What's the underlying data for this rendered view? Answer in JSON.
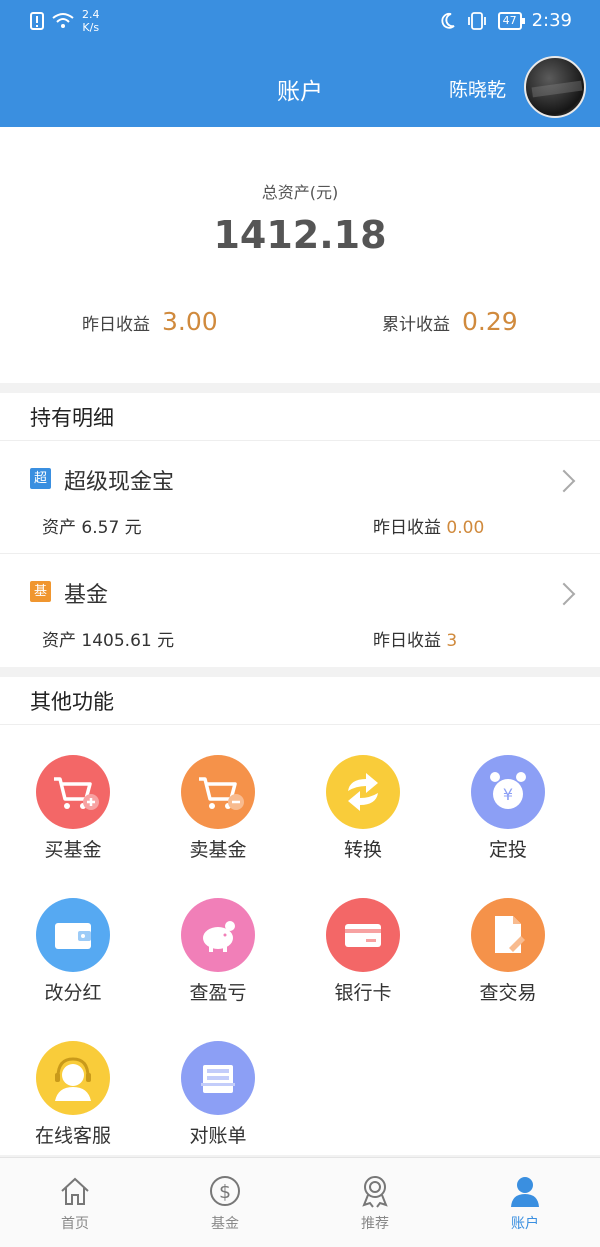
{
  "status_bar": {
    "speed_value": "2.4",
    "speed_unit": "K/s",
    "battery": "47",
    "time": "2:39"
  },
  "header": {
    "title": "账户",
    "username": "陈晓乾"
  },
  "summary": {
    "total_label": "总资产(元)",
    "total_value": "1412.18",
    "yesterday_label": "昨日收益",
    "yesterday_value": "3.00",
    "cumulative_label": "累计收益",
    "cumulative_value": "0.29"
  },
  "holdings": {
    "title": "持有明细",
    "items": [
      {
        "tag": "超",
        "name": "超级现金宝",
        "asset_text": "资产 6.57 元",
        "income_label": "昨日收益 ",
        "income_value": "0.00"
      },
      {
        "tag": "基",
        "name": "基金",
        "asset_text": "资产 1405.61 元",
        "income_label": "昨日收益 ",
        "income_value": "3"
      }
    ]
  },
  "features": {
    "title": "其他功能",
    "items": [
      {
        "label": "买基金",
        "icon": "cart-plus-icon",
        "color": "#f36767"
      },
      {
        "label": "卖基金",
        "icon": "cart-minus-icon",
        "color": "#f5924a"
      },
      {
        "label": "转换",
        "icon": "exchange-icon",
        "color": "#f9cc3a"
      },
      {
        "label": "定投",
        "icon": "alarm-clock-yen-icon",
        "color": "#8c9ff5"
      },
      {
        "label": "改分红",
        "icon": "wallet-icon",
        "color": "#56a9f2"
      },
      {
        "label": "查盈亏",
        "icon": "piggy-bank-icon",
        "color": "#f17fb8"
      },
      {
        "label": "银行卡",
        "icon": "bank-card-icon",
        "color": "#f36767"
      },
      {
        "label": "查交易",
        "icon": "document-edit-icon",
        "color": "#f5924a"
      },
      {
        "label": "在线客服",
        "icon": "customer-service-icon",
        "color": "#f9cc3a"
      },
      {
        "label": "对账单",
        "icon": "statement-icon",
        "color": "#8c9ff5"
      }
    ]
  },
  "tabbar": {
    "items": [
      {
        "label": "首页",
        "icon": "home-icon"
      },
      {
        "label": "基金",
        "icon": "dollar-circle-icon"
      },
      {
        "label": "推荐",
        "icon": "award-badge-icon"
      },
      {
        "label": "账户",
        "icon": "user-icon"
      }
    ],
    "active_color": "#3a8fe0"
  }
}
